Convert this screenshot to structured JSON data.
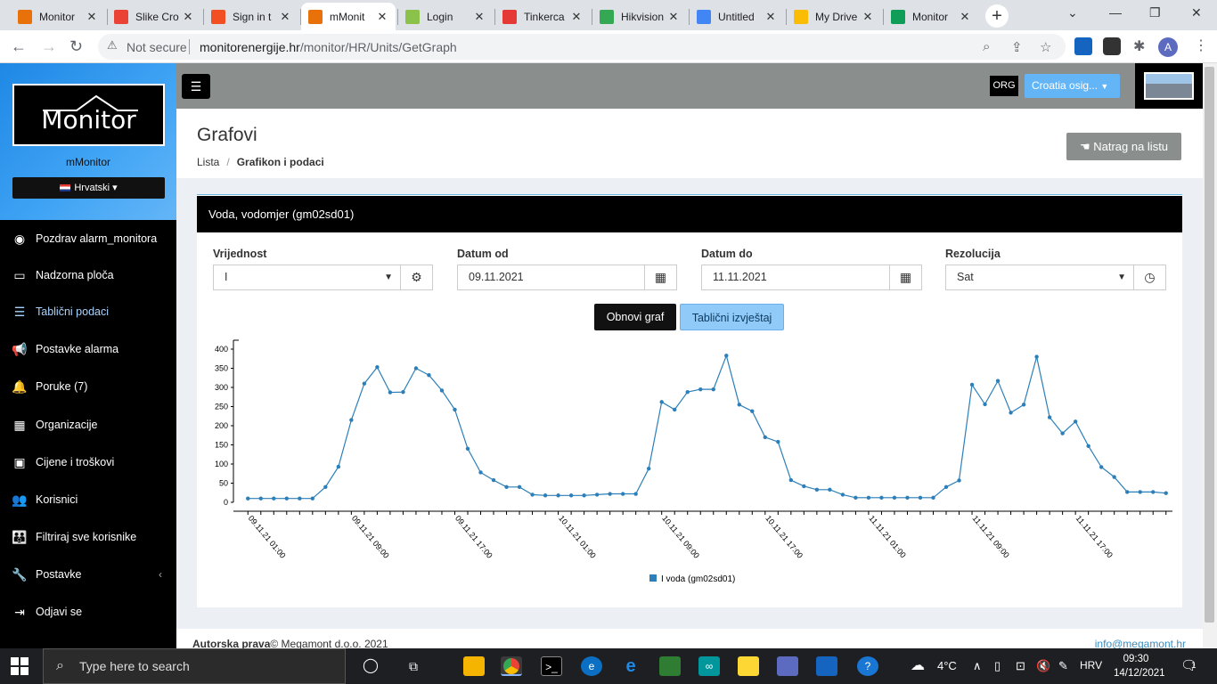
{
  "browser": {
    "tabs": [
      {
        "label": "Monitor",
        "active": false,
        "fav_color": "#e8710a"
      },
      {
        "label": "Slike Cro",
        "active": false,
        "fav_color": "#ea4335"
      },
      {
        "label": "Sign in t",
        "active": false,
        "fav_color": "#f25022"
      },
      {
        "label": "mMonit",
        "active": true,
        "fav_color": "#e8710a"
      },
      {
        "label": "Login",
        "active": false,
        "fav_color": "#8bc34a"
      },
      {
        "label": "Tinkerca",
        "active": false,
        "fav_color": "#e53935"
      },
      {
        "label": "Hikvision",
        "active": false,
        "fav_color": "#34a853"
      },
      {
        "label": "Untitled",
        "active": false,
        "fav_color": "#4285f4"
      },
      {
        "label": "My Drive",
        "active": false,
        "fav_color": "#fbbc04"
      },
      {
        "label": "Monitor",
        "active": false,
        "fav_color": "#0f9d58"
      }
    ],
    "security": "Not secure",
    "url_host": "monitorenergije.hr",
    "url_path": "/monitor/HR/Units/GetGraph",
    "profile_initial": "A"
  },
  "sidebar": {
    "logo_text": "Monitor",
    "app_name": "mMonitor",
    "language": "Hrvatski",
    "items": [
      {
        "label": "Pozdrav alarm_monitora",
        "icon": "user-circle-icon",
        "glyph": "◉",
        "active": false
      },
      {
        "label": "Nadzorna ploča",
        "icon": "monitor-icon",
        "glyph": "▭",
        "active": false
      },
      {
        "label": "Tablični podaci",
        "icon": "list-icon",
        "glyph": "☰",
        "active": true
      },
      {
        "label": "Postavke alarma",
        "icon": "bullhorn-icon",
        "glyph": "📢",
        "active": false
      },
      {
        "label": "Poruke (7)",
        "icon": "bell-icon",
        "glyph": "🔔",
        "active": false
      },
      {
        "label": "Organizacije",
        "icon": "building-icon",
        "glyph": "▦",
        "active": false
      },
      {
        "label": "Cijene i troškovi",
        "icon": "money-icon",
        "glyph": "▣",
        "active": false
      },
      {
        "label": "Korisnici",
        "icon": "users-icon",
        "glyph": "👥",
        "active": false
      },
      {
        "label": "Filtriraj sve korisnike",
        "icon": "users-filter-icon",
        "glyph": "👪",
        "active": false
      },
      {
        "label": "Postavke",
        "icon": "wrench-icon",
        "glyph": "🔧",
        "active": false
      },
      {
        "label": "Odjavi se",
        "icon": "sign-out-icon",
        "glyph": "⇥",
        "active": false
      }
    ]
  },
  "topbar": {
    "org_badge": "ORG",
    "org_select": "Croatia osig..."
  },
  "page": {
    "title": "Grafovi",
    "breadcrumb_root": "Lista",
    "breadcrumb_current": "Grafikon i podaci",
    "back_button": "Natrag na listu",
    "panel_title": "Voda, vodomjer (gm02sd01)",
    "filters": {
      "value_label": "Vrijednost",
      "value_selected": "I",
      "date_from_label": "Datum od",
      "date_from": "09.11.2021",
      "date_to_label": "Datum do",
      "date_to": "11.11.2021",
      "resolution_label": "Rezolucija",
      "resolution_selected": "Sat"
    },
    "refresh_button": "Obnovi graf",
    "table_button": "Tablični izvještaj"
  },
  "chart_data": {
    "type": "line",
    "ylim": [
      0,
      400
    ],
    "yticks": [
      0,
      50,
      100,
      150,
      200,
      250,
      300,
      350,
      400
    ],
    "xtick_labels": [
      "09.11.21 01:00",
      "09.11.21 09:00",
      "09.11.21 17:00",
      "10.11.21 01:00",
      "10.11.21 09:00",
      "10.11.21 17:00",
      "11.11.21 01:00",
      "11.11.21 09:00",
      "11.11.21 17:00"
    ],
    "legend": "top-less bottom-center",
    "color": "#2c7fb8",
    "series": [
      {
        "name": "I voda (gm02sd01)",
        "values": [
          10,
          10,
          10,
          10,
          10,
          10,
          40,
          93,
          215,
          310,
          353,
          287,
          288,
          350,
          332,
          292,
          242,
          140,
          78,
          58,
          40,
          40,
          20,
          18,
          18,
          18,
          18,
          20,
          22,
          22,
          22,
          88,
          262,
          242,
          288,
          295,
          295,
          383,
          255,
          238,
          170,
          158,
          58,
          42,
          33,
          33,
          20,
          12,
          12,
          12,
          12,
          12,
          12,
          12,
          40,
          57,
          307,
          256,
          317,
          234,
          255,
          380,
          222,
          180,
          211,
          147,
          92,
          66,
          27,
          27,
          27,
          24
        ]
      }
    ]
  },
  "footer": {
    "copyright_bold": "Autorska prava",
    "copyright_rest": "© Megamont d.o.o. 2021",
    "email": "info@megamont.hr"
  },
  "taskbar": {
    "search_placeholder": "Type here to search",
    "weather": "4°C",
    "language": "HRV",
    "time": "09:30",
    "date": "14/12/2021",
    "notifications": "1"
  }
}
